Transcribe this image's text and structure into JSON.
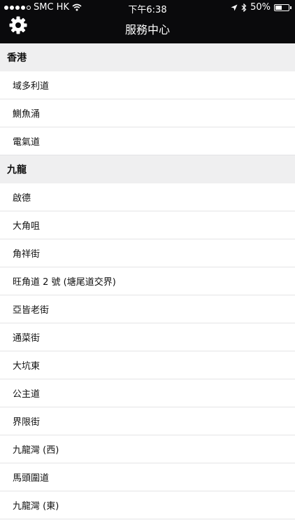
{
  "status_bar": {
    "carrier": "SMC HK",
    "time": "下午6:38",
    "battery": "50%",
    "battery_level": 0.5
  },
  "nav": {
    "title": "服務中心",
    "settings_icon": "gear-icon"
  },
  "sections": [
    {
      "header": "香港",
      "items": [
        "域多利道",
        "鰂魚涌",
        "電氣道"
      ]
    },
    {
      "header": "九龍",
      "items": [
        "啟德",
        "大角咀",
        "角祥街",
        "旺角道 2 號 (塘尾道交界)",
        "亞皆老街",
        "通菜街",
        "大坑東",
        "公主道",
        "界限街",
        "九龍灣 (西)",
        "馬頭圍道",
        "九龍灣 (東)"
      ]
    }
  ]
}
